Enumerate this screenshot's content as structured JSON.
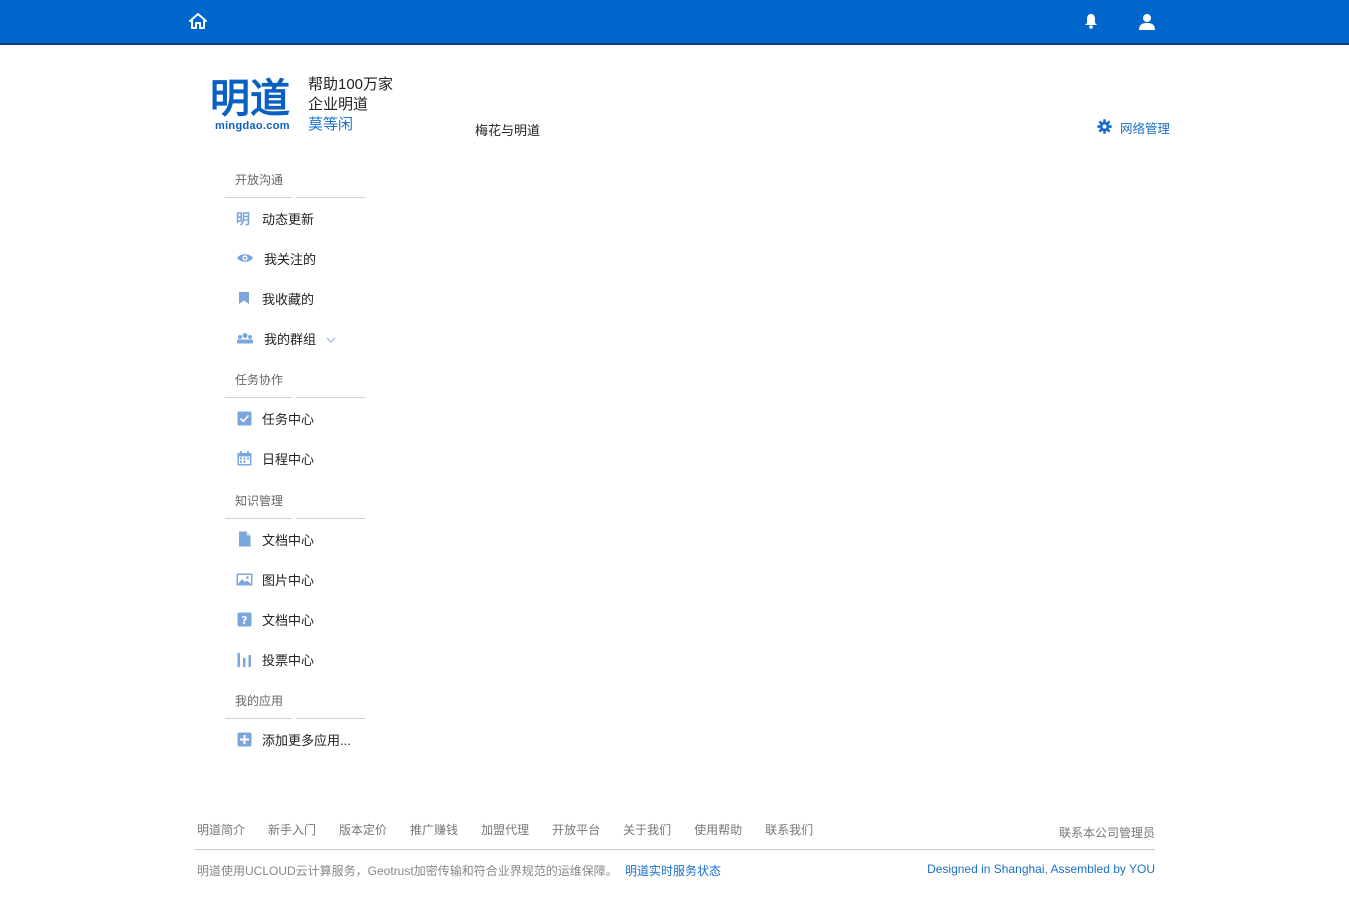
{
  "topbar": {
    "home_icon": "home-icon",
    "bell_icon": "bell-icon",
    "user_icon": "user-icon"
  },
  "brand": {
    "logo_text": "明道",
    "logo_sub": "mingdao.com",
    "slogan_line1": "帮助100万家",
    "slogan_line2": "企业明道",
    "user_name": "莫等闲"
  },
  "header": {
    "network_name": "梅花与明道",
    "network_admin": "网络管理"
  },
  "sidebar": {
    "sections": [
      {
        "title": "开放沟通",
        "items": [
          {
            "label": "动态更新",
            "icon": "ming-icon"
          },
          {
            "label": "我关注的",
            "icon": "eye-icon"
          },
          {
            "label": "我收藏的",
            "icon": "bookmark-icon"
          },
          {
            "label": "我的群组",
            "icon": "group-icon"
          }
        ]
      },
      {
        "title": "任务协作",
        "items": [
          {
            "label": "任务中心",
            "icon": "checkbox-icon"
          },
          {
            "label": "日程中心",
            "icon": "calendar-icon"
          }
        ]
      },
      {
        "title": "知识管理",
        "items": [
          {
            "label": "文档中心",
            "icon": "document-icon"
          },
          {
            "label": "图片中心",
            "icon": "image-icon"
          },
          {
            "label": "文档中心",
            "icon": "question-icon"
          },
          {
            "label": "投票中心",
            "icon": "bar-chart-icon"
          }
        ]
      },
      {
        "title": "我的应用",
        "items": [
          {
            "label": "添加更多应用...",
            "icon": "plus-icon"
          }
        ]
      }
    ]
  },
  "footer": {
    "links": [
      "明道简介",
      "新手入门",
      "版本定价",
      "推广赚钱",
      "加盟代理",
      "开放平台",
      "关于我们",
      "使用帮助",
      "联系我们"
    ],
    "contact": "联系本公司管理员",
    "note": "明道使用UCLOUD云计算服务，Geotrust加密传输和符合业界规范的运维保障。",
    "status": "明道实时服务状态",
    "credit": "Designed in Shanghai, Assembled by YOU"
  },
  "colors": {
    "topbar": "#0066cc",
    "accent": "#1a6fcc",
    "icon": "#7ba7dd"
  }
}
